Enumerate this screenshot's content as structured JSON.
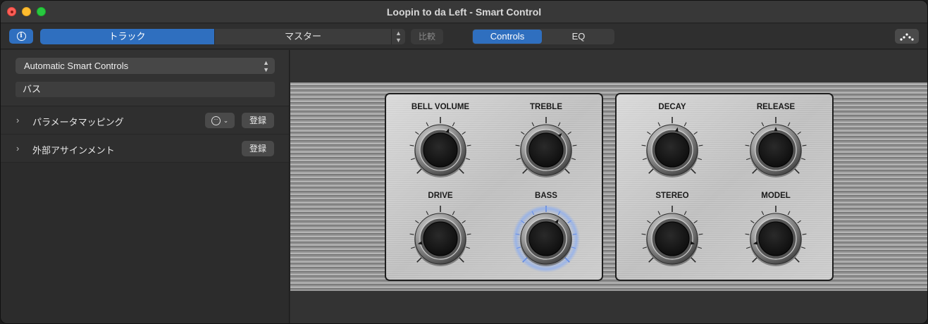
{
  "window": {
    "title": "Loopin to da Left - Smart Control"
  },
  "toolbar": {
    "track_label": "トラック",
    "master_label": "マスター",
    "compare_label": "比較",
    "view_controls_label": "Controls",
    "view_eq_label": "EQ"
  },
  "inspector": {
    "layout_popup": "Automatic Smart Controls",
    "name_field": "バス",
    "sections": [
      {
        "label": "パラメータマッピング",
        "button": "登録"
      },
      {
        "label": "外部アサインメント",
        "button": "登録"
      }
    ]
  },
  "knobs": [
    {
      "label": "BELL VOLUME",
      "value": 0.58
    },
    {
      "label": "TREBLE",
      "value": 0.66
    },
    {
      "label": "DECAY",
      "value": 0.55
    },
    {
      "label": "RELEASE",
      "value": 0.5
    },
    {
      "label": "DRIVE",
      "value": 0.12
    },
    {
      "label": "BASS",
      "value": 0.62,
      "selected": true
    },
    {
      "label": "STEREO",
      "value": 0.88
    },
    {
      "label": "MODEL",
      "value": 0.12
    }
  ],
  "colors": {
    "accent": "#2f6fbf",
    "close": "#fe5f57",
    "minimize": "#febc2e",
    "maximize": "#28c840",
    "selected_glow": "#7aa6ff"
  }
}
